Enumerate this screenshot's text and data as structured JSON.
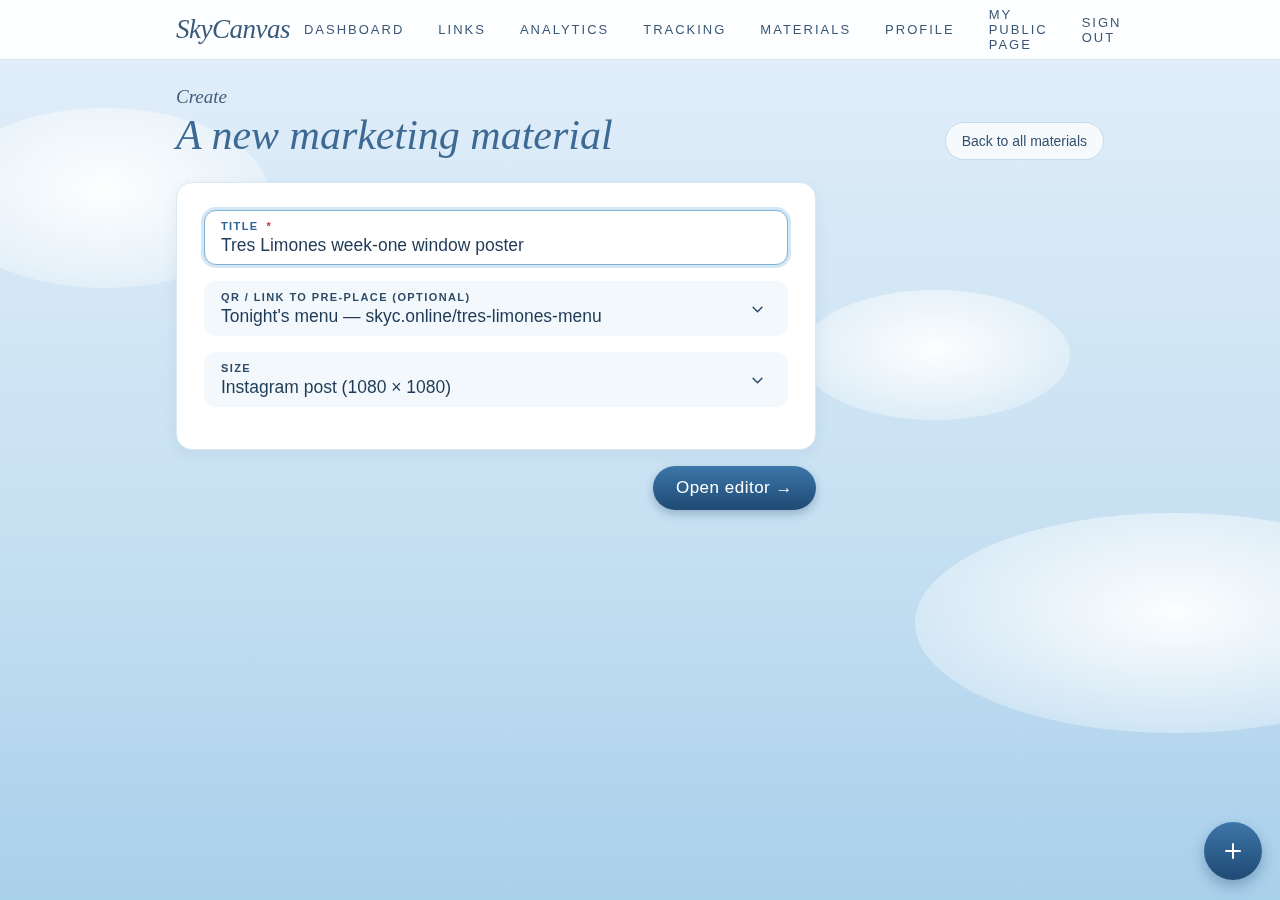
{
  "header": {
    "logo": "SkyCanvas",
    "nav": [
      {
        "label": "DASHBOARD",
        "selected": false
      },
      {
        "label": "LINKS",
        "selected": false
      },
      {
        "label": "ANALYTICS",
        "selected": false
      },
      {
        "label": "TRACKING",
        "selected": false
      },
      {
        "label": "MATERIALS",
        "selected": false
      },
      {
        "label": "PROFILE",
        "selected": false
      },
      {
        "label": "MY PUBLIC PAGE",
        "selected": false
      },
      {
        "label": "SIGN OUT",
        "selected": false
      }
    ]
  },
  "page": {
    "eyebrow": "Create",
    "title": "A new marketing material",
    "back_button": "Back to all materials"
  },
  "form": {
    "fields": [
      {
        "kind": "text",
        "label": "TITLE",
        "required_mark": "*",
        "value": "Tres Limones week-one window poster",
        "focused": true
      },
      {
        "kind": "select",
        "label": "QR / LINK TO PRE-PLACE (OPTIONAL)",
        "value": "Tonight's menu — skyc.online/tres-limones-menu",
        "focused": false
      },
      {
        "kind": "select",
        "label": "SIZE",
        "value": "Instagram post (1080 × 1080)",
        "focused": false
      }
    ],
    "submit": "Open editor →"
  },
  "fab": {
    "kind": "add"
  }
}
